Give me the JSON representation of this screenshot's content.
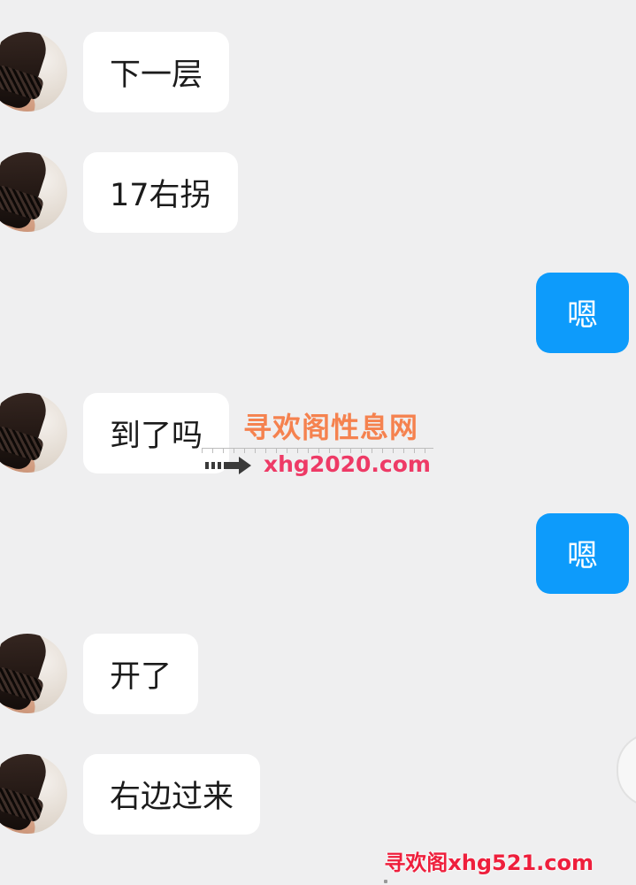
{
  "messages": [
    {
      "side": "in",
      "text": "下一层"
    },
    {
      "side": "in",
      "text": "17右拐"
    },
    {
      "side": "out",
      "text": "嗯"
    },
    {
      "side": "in",
      "text": "到了吗"
    },
    {
      "side": "out",
      "text": "嗯"
    },
    {
      "side": "in",
      "text": "开了"
    },
    {
      "side": "in",
      "text": "右边过来"
    }
  ],
  "watermark": {
    "title": "寻欢阁性息网",
    "url": "xhg2020.com",
    "bottom": "寻欢阁xhg521.com"
  },
  "colors": {
    "background": "#efeff0",
    "incoming_bubble": "#ffffff",
    "outgoing_bubble": "#0d9bfb",
    "watermark_title": "#f5824f",
    "watermark_url": "#ee3a66",
    "watermark_bottom": "#ee1f3c"
  }
}
